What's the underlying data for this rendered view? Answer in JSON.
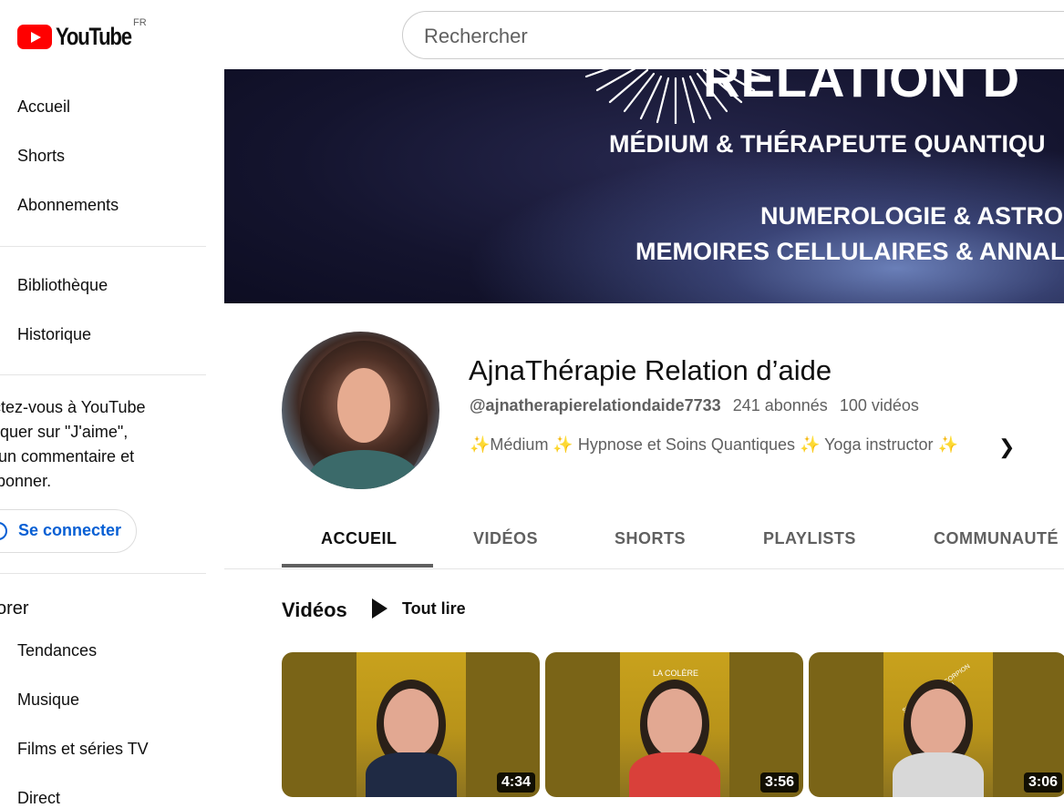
{
  "header": {
    "logo_text": "YouTube",
    "country_code": "FR",
    "search_placeholder": "Rechercher"
  },
  "sidebar": {
    "items": [
      {
        "label": "Accueil"
      },
      {
        "label": "Shorts"
      },
      {
        "label": "Abonnements"
      },
      {
        "label": "Bibliothèque"
      },
      {
        "label": "Historique"
      }
    ],
    "signin_prompt": "nectez-vous à YouTube r cliquer sur \"J'aime\", ter un commentaire et s abonner.",
    "signin_lines": [
      "nectez-vous à YouTube",
      "r cliquer sur \"J'aime\",",
      "ter un commentaire et",
      "s abonner."
    ],
    "signin_button": "Se connecter",
    "explore_title": "orer",
    "explore_items": [
      {
        "label": "Tendances"
      },
      {
        "label": "Musique"
      },
      {
        "label": "Films et séries TV"
      },
      {
        "label": "Direct"
      }
    ]
  },
  "banner": {
    "top_text": "RELATION D",
    "line1": "MÉDIUM & THÉRAPEUTE QUANTIQU",
    "line2": "NUMEROLOGIE & ASTRO",
    "line3": "MEMOIRES CELLULAIRES & ANNAL"
  },
  "channel": {
    "name": "AjnaThérapie Relation d’aide",
    "handle": "@ajnatherapierelationdaide7733",
    "subscribers": "241 abonnés",
    "video_count": "100 vidéos",
    "description": "✨Médium ✨ Hypnose et Soins Quantiques ✨ Yoga instructor ✨"
  },
  "tabs": [
    {
      "label": "ACCUEIL",
      "active": true
    },
    {
      "label": "VIDÉOS",
      "active": false
    },
    {
      "label": "SHORTS",
      "active": false
    },
    {
      "label": "PLAYLISTS",
      "active": false
    },
    {
      "label": "COMMUNAUTÉ",
      "active": false
    }
  ],
  "videos_section": {
    "title": "Vidéos",
    "play_all_label": "Tout lire",
    "items": [
      {
        "duration": "4:34",
        "overlay_text": ""
      },
      {
        "duration": "3:56",
        "overlay_text": "LA COLÈRE"
      },
      {
        "duration": "3:06",
        "overlay_text": "SIGNES D'EAU SCORPION CANCER POISSON"
      }
    ]
  },
  "colors": {
    "brand_red": "#ff0000",
    "link_blue": "#065fd4",
    "thumb_mustard": "#c9a21c"
  }
}
